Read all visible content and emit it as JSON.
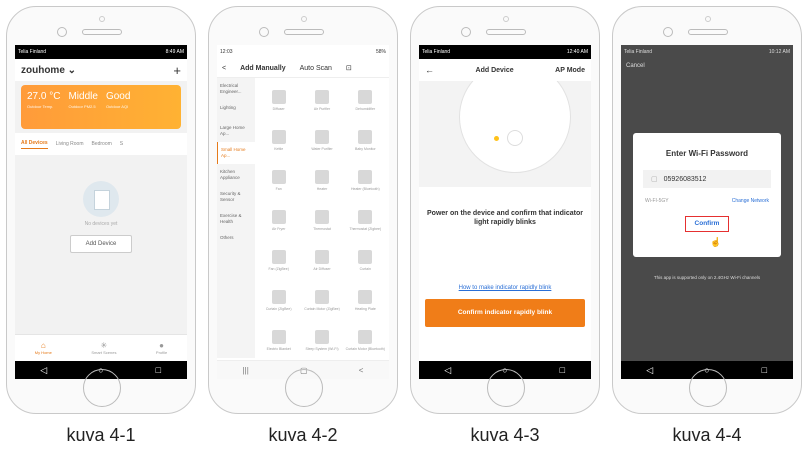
{
  "captions": [
    "kuva 4-1",
    "kuva 4-2",
    "kuva 4-3",
    "kuva 4-4"
  ],
  "screen1": {
    "status_left": "Telia Finland",
    "status_right": "8:49 AM",
    "home_name": "zouhome ⌄",
    "plus_icon": "+",
    "weather": [
      {
        "value": "27.0 °C",
        "label": "Outdoor Temp."
      },
      {
        "value": "Middle",
        "label": "Outdoor PM2.5"
      },
      {
        "value": "Good",
        "label": "Outdoor AQI"
      }
    ],
    "tabs": [
      "All Devices",
      "Living Room",
      "Bedroom",
      "S"
    ],
    "empty_text": "No devices yet",
    "add_device": "Add Device",
    "bottom_nav": [
      {
        "icon": "⌂",
        "label": "My Home"
      },
      {
        "icon": "✳",
        "label": "Smart Scenes"
      },
      {
        "icon": "●",
        "label": "Profile"
      }
    ],
    "nav_icons": [
      "◁",
      "○",
      "□"
    ]
  },
  "screen2": {
    "status_left": "12:03",
    "status_right": "58%",
    "back": "<",
    "tab_manual": "Add Manually",
    "tab_auto": "Auto Scan",
    "scan_icon": "⊡",
    "categories": [
      "Electrical Engineer...",
      "Lighting",
      "Large Home Ap...",
      "Small Home Ap...",
      "Kitchen Appliance",
      "Security & Sensor",
      "Exercise & Health",
      "Others"
    ],
    "active_category": 3,
    "grid_labels": [
      "Diffuser",
      "Air Purifier",
      "Dehumidifier",
      "Kettle",
      "Water Purifier",
      "Baby Monitor",
      "Fan",
      "Heater",
      "Heater (Bluetooth)",
      "Air Fryer",
      "Thermostat",
      "Thermostat (Zigbee)",
      "Fan (ZigBee)",
      "Air Diffuser",
      "Curtain",
      "Curtain (ZigBee)",
      "Curtain Motor (ZigBee)",
      "Heating Plate",
      "Electric Blanket",
      "Sleep System (Wi-Fi)",
      "Curtain Motor (Bluetooth)"
    ],
    "nav_icons": [
      "|||",
      "▢",
      "<"
    ]
  },
  "screen3": {
    "status_left": "Telia Finland",
    "status_right": "12:40 AM",
    "back": "←",
    "title": "Add Device",
    "mode": "AP Mode",
    "instruction": "Power on the device and confirm that indicator light rapidly blinks",
    "help_link": "How to make indicator rapidly blink",
    "confirm": "Confirm indicator rapidly blink",
    "nav_icons": [
      "◁",
      "○",
      "□"
    ]
  },
  "screen4": {
    "status_left": "Telia Finland",
    "status_right": "10:12 AM",
    "cancel": "Cancel",
    "dialog_title": "Enter Wi-Fi Password",
    "password": "05926083512",
    "ssid": "Wi-FI-5GY",
    "change_network": "Change Network",
    "confirm": "Confirm",
    "note": "This app is supported only on 2.4GHz Wi-Fi channels",
    "nav_icons": [
      "◁",
      "○",
      "□"
    ]
  }
}
